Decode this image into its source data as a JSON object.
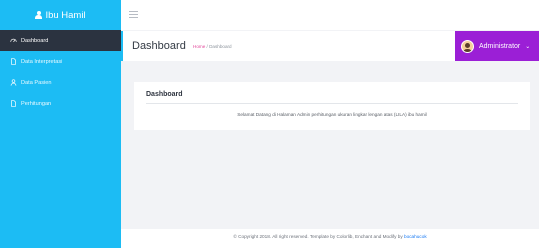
{
  "brand": {
    "title": "Ibu Hamil"
  },
  "sidebar": {
    "items": [
      {
        "label": "Dashboard",
        "icon": "dashboard-icon",
        "active": true
      },
      {
        "label": "Data Interpretasi",
        "icon": "document-icon",
        "active": false
      },
      {
        "label": "Data Pasien",
        "icon": "user-icon",
        "active": false
      },
      {
        "label": "Perhitungan",
        "icon": "document-icon",
        "active": false
      }
    ]
  },
  "header": {
    "page_title": "Dashboard",
    "breadcrumb_home": "Home",
    "breadcrumb_sep": "/",
    "breadcrumb_current": "Dashboard",
    "user_name": "Administrator"
  },
  "card": {
    "title": "Dashboard",
    "text": "Selamat Datang di Halaman Admin perhitungan ukuran lingkar lengan atas (LILA) ibu hamil"
  },
  "footer": {
    "text": "© Copyright 2018. All right reserved. Template by Colorlib, Enchant and Modify by ",
    "link": "bocahucok"
  },
  "colors": {
    "sidebar": "#1cbcf4",
    "sidebar_active": "#2b3340",
    "admin": "#9b1fd6",
    "breadcrumb_home": "#e2479a"
  }
}
